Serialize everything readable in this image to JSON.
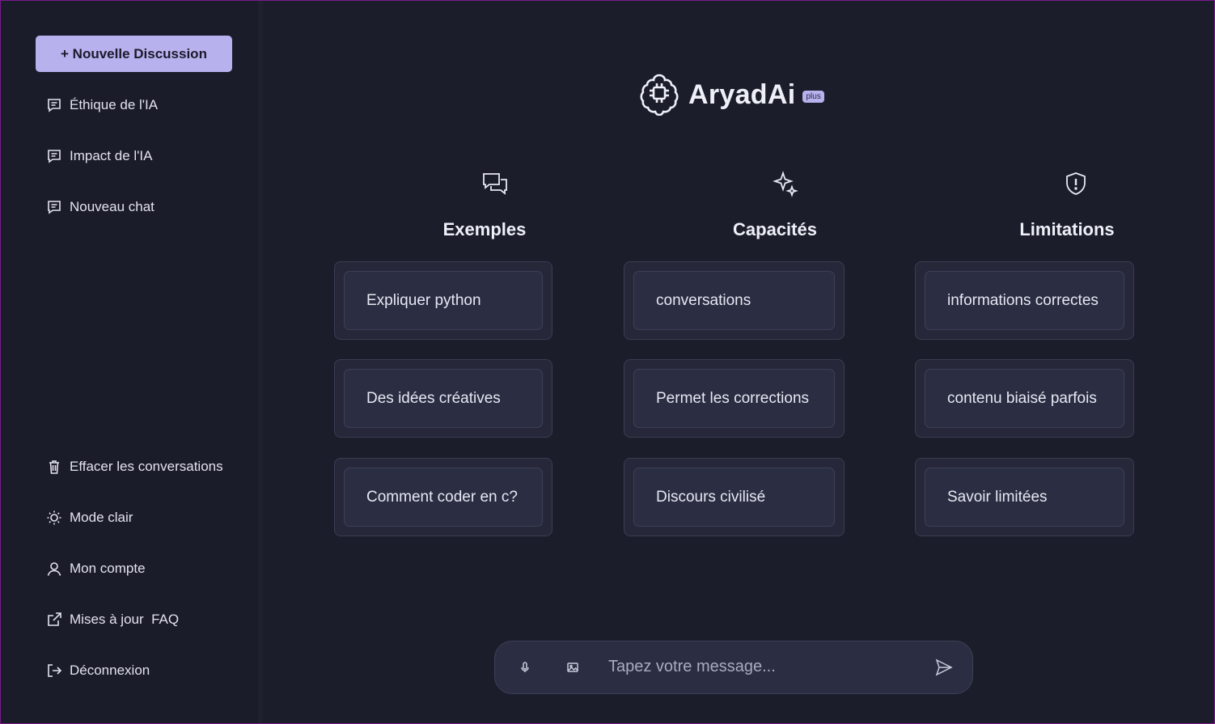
{
  "sidebar": {
    "new_chat_label": "+ Nouvelle Discussion",
    "history": [
      {
        "label": "Éthique de l'IA",
        "icon": "chat-icon"
      },
      {
        "label": "Impact de l'IA",
        "icon": "chat-icon"
      },
      {
        "label": "Nouveau chat",
        "icon": "chat-icon"
      }
    ],
    "bottom": [
      {
        "label": "Effacer les conversations",
        "icon": "trash-icon"
      },
      {
        "label": "Mode clair",
        "icon": "sun-icon"
      },
      {
        "label": "Mon compte",
        "icon": "user-icon"
      },
      {
        "label": "Mises à jour  FAQ",
        "icon": "external-link-icon"
      },
      {
        "label": "Déconnexion",
        "icon": "logout-icon"
      }
    ]
  },
  "brand": {
    "name": "AryadAi",
    "badge": "plus",
    "icon": "brain-chip-icon"
  },
  "columns": [
    {
      "title": "Exemples",
      "icon": "chat-bubbles-icon",
      "cards": [
        "Expliquer python",
        "Des idées créatives",
        "Comment coder en c?"
      ]
    },
    {
      "title": "Capacités",
      "icon": "sparkles-icon",
      "cards": [
        "conversations",
        "Permet les corrections",
        "Discours civilisé"
      ]
    },
    {
      "title": "Limitations",
      "icon": "shield-alert-icon",
      "cards": [
        "informations correctes",
        "contenu biaisé parfois",
        "Savoir limitées"
      ]
    }
  ],
  "composer": {
    "placeholder": "Tapez votre message...",
    "mic_icon": "microphone-icon",
    "image_icon": "image-icon",
    "send_icon": "send-icon"
  },
  "colors": {
    "background": "#1c1d2b",
    "accent": "#b7b1ee",
    "card": "#2b2d42",
    "border": "#7a1a8c"
  }
}
